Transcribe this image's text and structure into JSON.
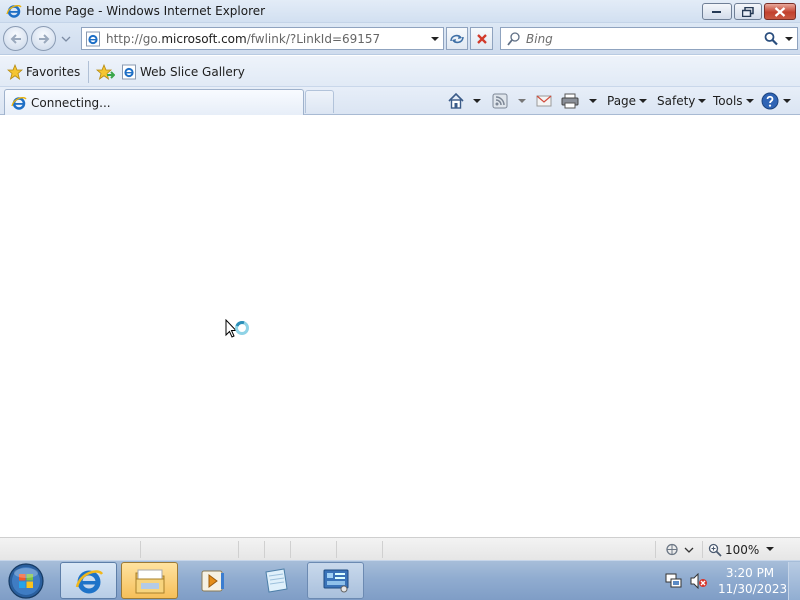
{
  "window": {
    "title": "Home Page - Windows Internet Explorer"
  },
  "navigation": {
    "address_prefix": "http://go.",
    "address_host": "microsoft.com",
    "address_path": "/fwlink/?LinkId=69157",
    "search_placeholder": "Bing"
  },
  "favorites_bar": {
    "favorites_label": "Favorites",
    "links": [
      {
        "label": "Web Slice Gallery"
      }
    ]
  },
  "tabs": [
    {
      "label": "Connecting...",
      "active": true
    }
  ],
  "command_bar": {
    "page_label": "Page",
    "safety_label": "Safety",
    "tools_label": "Tools"
  },
  "status_bar": {
    "zoom": "100%"
  },
  "taskbar": {
    "clock_time": "3:20 PM",
    "clock_date": "11/30/2023"
  },
  "icons": {
    "app": "ie-logo-icon",
    "back": "back-arrow-icon",
    "forward": "forward-arrow-icon",
    "stop": "stop-x-icon",
    "refresh": "compatibility-view-icon",
    "search": "magnifier-icon",
    "busy_cursor": "busy-pointer-icon"
  }
}
